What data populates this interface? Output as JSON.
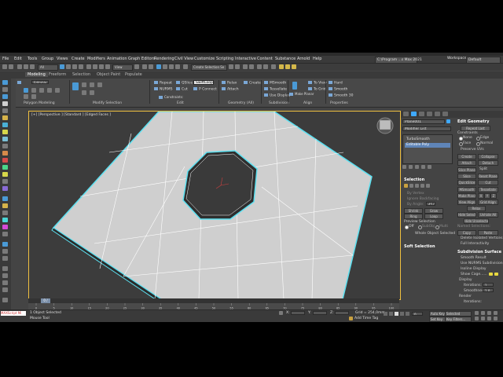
{
  "menu": {
    "items": [
      "File",
      "Edit",
      "Tools",
      "Group",
      "Views",
      "Create",
      "Modifiers",
      "Animation",
      "Graph Editors",
      "Rendering",
      "Civil View",
      "Customize",
      "Scripting",
      "Interactive",
      "Content",
      "Substance",
      "Arnold",
      "Help"
    ],
    "workspace_path": "C:\\Program ...s Max 2021",
    "workspaces_label": "Workspaces:",
    "workspace_value": "Default"
  },
  "toolbar": {
    "filter_value": "All",
    "view_value": "View",
    "create_selection": "Create Selection Se"
  },
  "ribbon": {
    "tabs": [
      "Modeling",
      "Freeform",
      "Selection",
      "Object Paint",
      "Populate"
    ],
    "active_tab": "Modeling",
    "object_label": "Editable Poly",
    "groups": [
      "Polygon Modeling",
      "Modify Selection",
      "Edit",
      "Geometry (All)",
      "Subdivision",
      "Align",
      "Properties"
    ],
    "edit_buttons": [
      "Repeat",
      "QSlice",
      "NURMS",
      "Cut",
      "Constraints:"
    ],
    "swiftloop_label": "SwiftLoop",
    "pconnect_label": "P Connect",
    "geometry_buttons": [
      "Relax",
      "Attach",
      "Create"
    ],
    "subdivision_buttons": [
      "MSmooth",
      "Tessellate",
      "Use Displac"
    ],
    "align_buttons": [
      "Make Planar",
      "To View",
      "To Grid"
    ],
    "properties_buttons": [
      "Hard",
      "Smooth",
      "Smooth 30"
    ]
  },
  "viewport": {
    "label": "[+] [Perspective ] [Standard ] [Edged Faces ]"
  },
  "command_panel": {
    "object_name": "Plane001",
    "modifier_list": "Modifier List",
    "stack_items": [
      "TurboSmooth",
      "Editable Poly"
    ],
    "selected_stack_item": "Editable Poly",
    "selection_header": "Selection",
    "selection_options": [
      "By Vertex",
      "Ignore Backfacing",
      "By Angle:",
      "Shrink",
      "Ring"
    ],
    "by_angle_value": "45.0",
    "grow_label": "Grow",
    "loop_label": "Loop",
    "preview_selection_label": "Preview Selection",
    "preview_options": [
      "Off",
      "SubObj",
      "Multi"
    ],
    "whole_object_selected": "Whole Object Selected",
    "soft_selection_header": "Soft Selection",
    "edit_geometry_header": "Edit Geometry",
    "repeat_last": "Repeat Last",
    "constraints_label": "Constraints",
    "constraint_options": [
      "None",
      "Edge",
      "Face",
      "Normal"
    ],
    "preserve_uvs": "Preserve UVs",
    "create_label": "Create",
    "collapse_label": "Collapse",
    "attach_label": "Attach",
    "detach_label": "Detach",
    "slice_plane": "Slice Plane",
    "split_label": "Split",
    "slice_label": "Slice",
    "reset_plane": "Reset Plane",
    "quickslice": "QuickSlice",
    "cut_label": "Cut",
    "msmooth": "MSmooth",
    "tessellate": "Tessellate",
    "make_planar": "Make Planar",
    "xyz": [
      "X",
      "Y",
      "Z"
    ],
    "view_align": "View Align",
    "grid_align": "Grid Align",
    "relax_label": "Relax",
    "hide_selected": "Hide Selected",
    "unhide_all": "Unhide All",
    "hide_unselected": "Hide Unselected",
    "named_selections": "Named Selections:",
    "copy_label": "Copy",
    "paste_label": "Paste",
    "delete_isolated": "Delete Isolated Vertices",
    "full_interactivity": "Full Interactivity",
    "subdivision_surface_header": "Subdivision Surface",
    "smooth_result": "Smooth Result",
    "use_nurms": "Use NURMS Subdivision",
    "isoline_display": "Isoline Display",
    "show_cage": "Show Cage......",
    "display_label": "Display",
    "iterations_label": "Iterations:",
    "iterations_value": "1",
    "smoothness_label": "Smoothness:",
    "smoothness_value": "1.0",
    "render_label": "Render",
    "render_iterations_label": "Iterations:"
  },
  "timeline": {
    "slider_label": "0 / 100",
    "ticks": [
      "0",
      "5",
      "10",
      "15",
      "20",
      "25",
      "30",
      "35",
      "40",
      "45",
      "50",
      "55",
      "60",
      "65",
      "70",
      "75",
      "80",
      "85",
      "90",
      "95",
      "100"
    ]
  },
  "status": {
    "selected": "1 Object Selected",
    "hint": "Mouse Tool",
    "maxscript": "MAXScript Mi",
    "x_label": "X:",
    "y_label": "Y:",
    "z_label": "Z:",
    "grid": "Grid = 254,0mm",
    "add_time_tag": "Add Time Tag",
    "auto_key": "Auto Key",
    "selected_dropdown": "Selected",
    "set_key": "Set Key",
    "key_filters": "Key Filters...",
    "frame_value": "0"
  },
  "colors": {
    "accent_blue": "#3fa9ff",
    "viewport_border": "#f0c040",
    "selection_cyan": "#5ce0f0",
    "mesh_fill": "#cfcfcf"
  }
}
